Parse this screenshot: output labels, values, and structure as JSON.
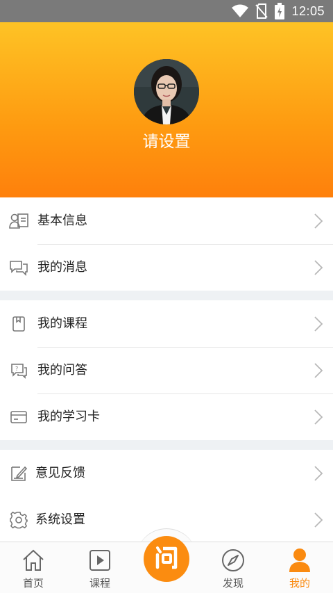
{
  "status_bar": {
    "time": "12:05",
    "icons": [
      "wifi-icon",
      "no-sim-icon",
      "battery-charging-icon"
    ]
  },
  "profile": {
    "nickname": "请设置",
    "colors": {
      "gradient_top": "#fec325",
      "gradient_bottom": "#fe800c"
    }
  },
  "menu": {
    "group1": [
      {
        "label": "基本信息",
        "icon": "profile-card-icon"
      },
      {
        "label": "我的消息",
        "icon": "chat-bubbles-icon"
      }
    ],
    "group2": [
      {
        "label": "我的课程",
        "icon": "course-book-icon"
      },
      {
        "label": "我的问答",
        "icon": "qa-bubble-icon"
      },
      {
        "label": "我的学习卡",
        "icon": "card-icon"
      }
    ],
    "group3": [
      {
        "label": "意见反馈",
        "icon": "feedback-edit-icon"
      },
      {
        "label": "系统设置",
        "icon": "gear-icon"
      }
    ]
  },
  "tabbar": {
    "tabs": [
      {
        "label": "首页",
        "icon": "home-icon",
        "active": false
      },
      {
        "label": "课程",
        "icon": "play-square-icon",
        "active": false
      },
      {
        "label": "",
        "icon": "ask-icon",
        "active": false
      },
      {
        "label": "发现",
        "icon": "compass-icon",
        "active": false
      },
      {
        "label": "我的",
        "icon": "person-icon",
        "active": true
      }
    ],
    "accent_color": "#fa8a10"
  }
}
